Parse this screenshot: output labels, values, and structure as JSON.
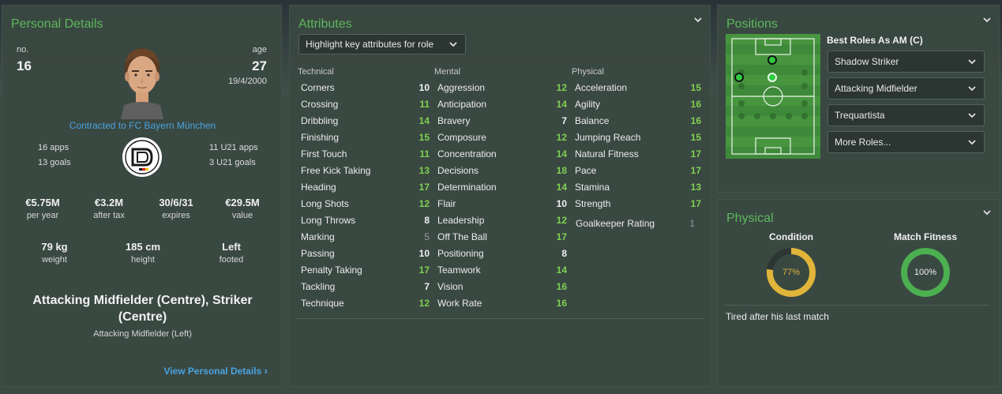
{
  "personal": {
    "title": "Personal Details",
    "no_label": "no.",
    "no_value": "16",
    "age_label": "age",
    "age_value": "27",
    "dob": "19/4/2000",
    "contract": "Contracted to FC Bayern München",
    "apps": "16 apps",
    "goals": "13 goals",
    "u21_apps": "11 U21 apps",
    "u21_goals": "3 U21 goals",
    "stats": [
      {
        "value": "€5.75M",
        "label": "per year"
      },
      {
        "value": "€3.2M",
        "label": "after tax"
      },
      {
        "value": "30/6/31",
        "label": "expires"
      },
      {
        "value": "€29.5M",
        "label": "value"
      }
    ],
    "body": [
      {
        "value": "79 kg",
        "label": "weight"
      },
      {
        "value": "185 cm",
        "label": "height"
      },
      {
        "value": "Left",
        "label": "footed"
      }
    ],
    "position_main": "Attacking Midfielder (Centre), Striker (Centre)",
    "position_sub": "Attacking Midfielder (Left)",
    "view_link": "View Personal Details"
  },
  "attributes": {
    "title": "Attributes",
    "highlight_dropdown": "Highlight key attributes for role",
    "technical_label": "Technical",
    "mental_label": "Mental",
    "physical_label": "Physical",
    "technical": [
      {
        "name": "Corners",
        "value": "10",
        "tone": "white"
      },
      {
        "name": "Crossing",
        "value": "11",
        "tone": "green"
      },
      {
        "name": "Dribbling",
        "value": "14",
        "tone": "green"
      },
      {
        "name": "Finishing",
        "value": "15",
        "tone": "green"
      },
      {
        "name": "First Touch",
        "value": "11",
        "tone": "green"
      },
      {
        "name": "Free Kick Taking",
        "value": "13",
        "tone": "green"
      },
      {
        "name": "Heading",
        "value": "17",
        "tone": "green"
      },
      {
        "name": "Long Shots",
        "value": "12",
        "tone": "green"
      },
      {
        "name": "Long Throws",
        "value": "8",
        "tone": "white"
      },
      {
        "name": "Marking",
        "value": "5",
        "tone": "grey"
      },
      {
        "name": "Passing",
        "value": "10",
        "tone": "white"
      },
      {
        "name": "Penalty Taking",
        "value": "17",
        "tone": "green"
      },
      {
        "name": "Tackling",
        "value": "7",
        "tone": "white"
      },
      {
        "name": "Technique",
        "value": "12",
        "tone": "green"
      }
    ],
    "mental": [
      {
        "name": "Aggression",
        "value": "12",
        "tone": "green"
      },
      {
        "name": "Anticipation",
        "value": "14",
        "tone": "green"
      },
      {
        "name": "Bravery",
        "value": "7",
        "tone": "white"
      },
      {
        "name": "Composure",
        "value": "12",
        "tone": "green"
      },
      {
        "name": "Concentration",
        "value": "14",
        "tone": "green"
      },
      {
        "name": "Decisions",
        "value": "18",
        "tone": "green"
      },
      {
        "name": "Determination",
        "value": "14",
        "tone": "green"
      },
      {
        "name": "Flair",
        "value": "10",
        "tone": "white"
      },
      {
        "name": "Leadership",
        "value": "12",
        "tone": "green"
      },
      {
        "name": "Off The Ball",
        "value": "17",
        "tone": "green"
      },
      {
        "name": "Positioning",
        "value": "8",
        "tone": "white"
      },
      {
        "name": "Teamwork",
        "value": "14",
        "tone": "green"
      },
      {
        "name": "Vision",
        "value": "16",
        "tone": "green"
      },
      {
        "name": "Work Rate",
        "value": "16",
        "tone": "green"
      }
    ],
    "physical": [
      {
        "name": "Acceleration",
        "value": "15",
        "tone": "green"
      },
      {
        "name": "Agility",
        "value": "16",
        "tone": "green"
      },
      {
        "name": "Balance",
        "value": "16",
        "tone": "green"
      },
      {
        "name": "Jumping Reach",
        "value": "15",
        "tone": "green"
      },
      {
        "name": "Natural Fitness",
        "value": "17",
        "tone": "green"
      },
      {
        "name": "Pace",
        "value": "17",
        "tone": "green"
      },
      {
        "name": "Stamina",
        "value": "13",
        "tone": "green"
      },
      {
        "name": "Strength",
        "value": "17",
        "tone": "green"
      }
    ],
    "goalkeeper_rating_label": "Goalkeeper Rating",
    "goalkeeper_rating_value": "1"
  },
  "positions": {
    "title": "Positions",
    "best_roles_title": "Best Roles As AM (C)",
    "roles": [
      "Shadow Striker",
      "Attacking Midfielder",
      "Trequartista",
      "More Roles..."
    ]
  },
  "physical": {
    "title": "Physical",
    "condition_label": "Condition",
    "condition_value": "77%",
    "condition_fraction": 0.77,
    "fitness_label": "Match Fitness",
    "fitness_value": "100%",
    "fitness_fraction": 1.0,
    "status_text": "Tired after his last match"
  },
  "colors": {
    "accent_green": "#5cb85c",
    "link_blue": "#4aa3df",
    "attr_green": "#7fd150",
    "condition_yellow": "#e0b53a",
    "fitness_green": "#4caf50"
  }
}
